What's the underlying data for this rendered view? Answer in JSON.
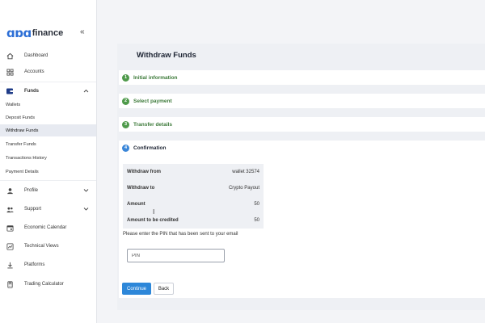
{
  "brand": {
    "mark": "ɑɒɑ",
    "name": "finance",
    "collapse_icon": "«"
  },
  "sidebar": {
    "items": [
      {
        "label": "Dashboard",
        "icon": "home-icon"
      },
      {
        "label": "Accounts",
        "icon": "grid-icon"
      }
    ],
    "funds": {
      "label": "Funds",
      "icon": "wallet-icon",
      "chevron": "^"
    },
    "sub_items": [
      {
        "label": "Wallets"
      },
      {
        "label": "Deposit Funds"
      },
      {
        "label": "Withdraw Funds",
        "active": true
      },
      {
        "label": "Transfer Funds"
      },
      {
        "label": "Transactions History"
      },
      {
        "label": "Payment Details"
      }
    ],
    "bottom_items": [
      {
        "label": "Profile",
        "icon": "user-icon",
        "chevron": "v"
      },
      {
        "label": "Support",
        "icon": "support-icon",
        "chevron": "v"
      },
      {
        "label": "Economic Calendar",
        "icon": "calendar-icon"
      },
      {
        "label": "Technical Views",
        "icon": "chart-icon"
      },
      {
        "label": "Platforms",
        "icon": "download-icon"
      },
      {
        "label": "Trading Calculator",
        "icon": "calculator-icon"
      }
    ]
  },
  "page": {
    "title": "Withdraw Funds"
  },
  "steps": [
    {
      "num": "1",
      "label": "Initial information",
      "state": "done"
    },
    {
      "num": "2",
      "label": "Select payment",
      "state": "done"
    },
    {
      "num": "3",
      "label": "Transfer details",
      "state": "done"
    },
    {
      "num": "4",
      "label": "Confirmation",
      "state": "current"
    }
  ],
  "summary": [
    {
      "key": "Withdraw from",
      "value": "wallet 32574"
    },
    {
      "key": "Withdraw to",
      "value": "Crypto Payout"
    },
    {
      "key": "Amount",
      "value": "50"
    },
    {
      "key": "Amount to be credited",
      "value": "50"
    }
  ],
  "pin": {
    "message": "Please enter the PIN that has been sent to your email",
    "placeholder": "PIN"
  },
  "buttons": {
    "continue": "Continue",
    "back": "Back"
  },
  "colors": {
    "accent": "#2d87d9",
    "step_done": "#4f9a4b",
    "step_current": "#3a86d8",
    "brand": "#2d6fd6"
  }
}
